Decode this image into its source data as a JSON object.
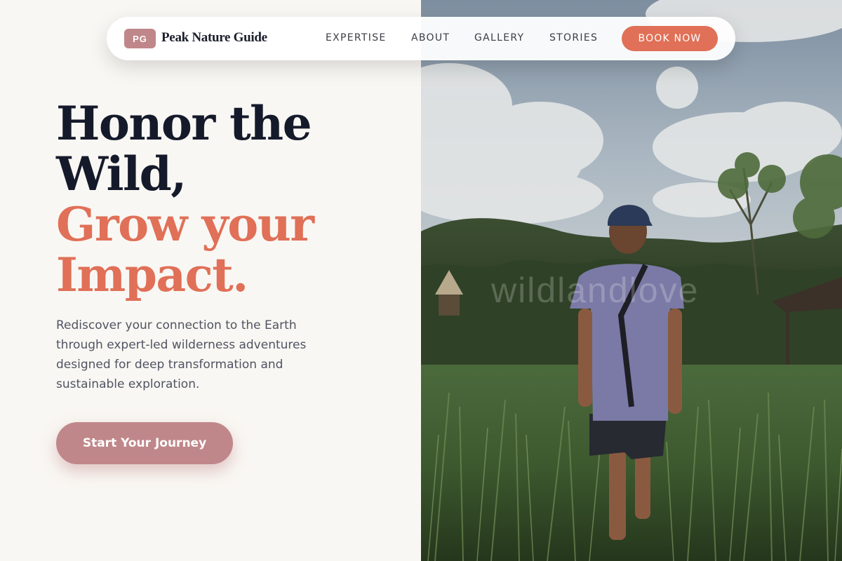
{
  "brand": {
    "badge": "PG",
    "name": "Peak Nature Guide"
  },
  "nav": {
    "links": [
      "EXPERTISE",
      "ABOUT",
      "GALLERY",
      "STORIES"
    ],
    "cta": "BOOK NOW"
  },
  "hero": {
    "headline_line1": "Honor the",
    "headline_line2": "Wild,",
    "headline_line3": "Grow your",
    "headline_line4": "Impact.",
    "subtitle": "Rediscover your connection to the Earth through expert-led wilderness adventures designed for deep transformation and sustainable exploration.",
    "cta": "Start Your Journey"
  },
  "photo": {
    "watermark": "wildlandlove"
  },
  "colors": {
    "accent": "#e07057",
    "rose": "#c0878a",
    "ink": "#151a2b",
    "background": "#f9f7f3"
  }
}
